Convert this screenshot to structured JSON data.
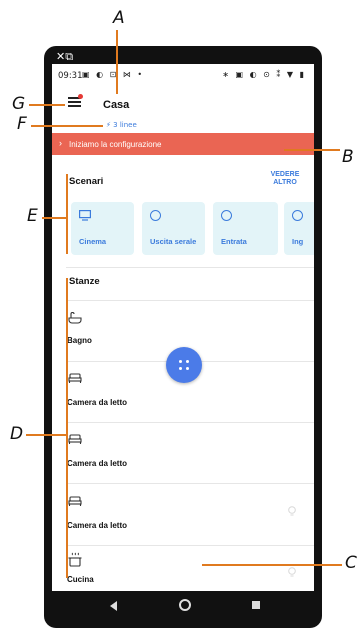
{
  "callouts": {
    "a": "A",
    "b": "B",
    "c": "C",
    "d": "D",
    "e": "E",
    "f": "F",
    "g": "G"
  },
  "window_icons": "✕⧉",
  "status": {
    "time": "09:31",
    "left_icons": "▣ ◐ ⊡ ⋈ •",
    "right_icons": "∗ ▣ ◐ ⊙ ⁑ ▼ ▮"
  },
  "header": {
    "title": "Casa",
    "lines": "⚡ 3 linee"
  },
  "banner": {
    "chevron": "›",
    "text": "Iniziamo la configurazione"
  },
  "scenarios": {
    "title": "Scenari",
    "see_more": "VEDERE ALTRO",
    "items": [
      {
        "label": "Cinema",
        "icon": "tv-icon"
      },
      {
        "label": "Uscita serale",
        "icon": "play-circle-icon"
      },
      {
        "label": "Entrata",
        "icon": "play-circle-icon"
      },
      {
        "label": "Ing",
        "icon": "play-circle-icon"
      }
    ]
  },
  "rooms": {
    "title": "Stanze",
    "items": [
      {
        "label": "Bagno",
        "icon": "bathtub-icon"
      },
      {
        "label": "Camera da letto",
        "icon": "bed-icon"
      },
      {
        "label": "Camera da letto",
        "icon": "bed-icon"
      },
      {
        "label": "Camera da letto",
        "icon": "bed-icon"
      },
      {
        "label": "Cucina",
        "icon": "cooking-pot-icon"
      }
    ]
  },
  "colors": {
    "accent": "#3b7bdc",
    "banner": "#ea6553",
    "card": "#e3f4f8",
    "fab": "#4b7be8",
    "callout": "#e07a1f"
  }
}
